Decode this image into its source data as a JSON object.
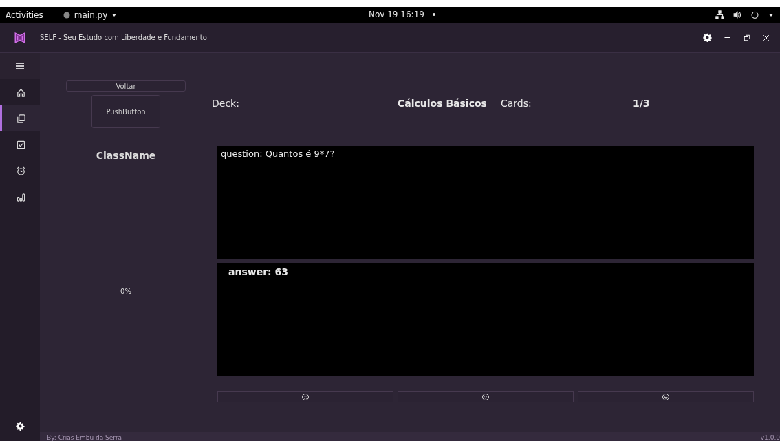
{
  "top_bar": {
    "activities": "Activities",
    "app_menu": "main.py",
    "clock": "Nov 19  16:19"
  },
  "window": {
    "title": "SELF - Seu Estudo com Liberdade e Fundamento"
  },
  "sidebar": {
    "items": [
      {
        "kind": "home",
        "selected": false
      },
      {
        "kind": "cards",
        "selected": true
      },
      {
        "kind": "check",
        "selected": false
      },
      {
        "kind": "alarm",
        "selected": false
      },
      {
        "kind": "chart",
        "selected": false
      }
    ]
  },
  "left_panel": {
    "back_button": "Voltar",
    "image_button": "PushButton",
    "class_name": "ClassName",
    "progress": "0%"
  },
  "deck": {
    "deck_label": "Deck:",
    "deck_name": "Cálculos Básicos",
    "cards_label": "Cards:",
    "cards_count": "1/3"
  },
  "question": "question: Quantos é 9*7?",
  "answer": "answer: 63",
  "rating_buttons": [
    {
      "kind": "sad"
    },
    {
      "kind": "smile"
    },
    {
      "kind": "grin"
    }
  ],
  "footer": {
    "credits": "By: Crias Embu da Serra",
    "version": "v1.0.0"
  }
}
